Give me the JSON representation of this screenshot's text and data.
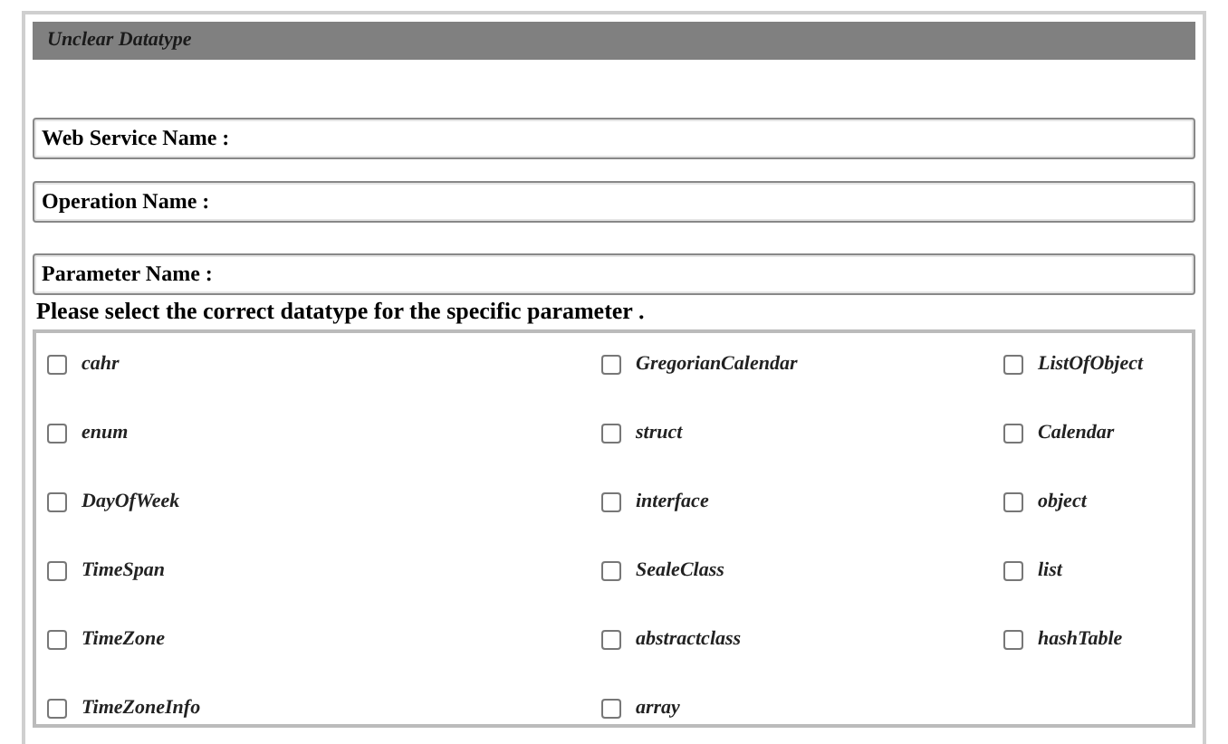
{
  "panel": {
    "title": "Unclear Datatype"
  },
  "fields": [
    {
      "label": "Web Service Name :"
    },
    {
      "label": "Operation Name :"
    },
    {
      "label": "Parameter Name :"
    }
  ],
  "instruction": "Please select the correct datatype for the specific parameter .",
  "options": [
    {
      "label": "cahr",
      "checked": false
    },
    {
      "label": "GregorianCalendar",
      "checked": false
    },
    {
      "label": "ListOfObject",
      "checked": false
    },
    {
      "label": "enum",
      "checked": false
    },
    {
      "label": "struct",
      "checked": false
    },
    {
      "label": "Calendar",
      "checked": false
    },
    {
      "label": "DayOfWeek",
      "checked": false
    },
    {
      "label": "interface",
      "checked": false
    },
    {
      "label": "object",
      "checked": false
    },
    {
      "label": "TimeSpan",
      "checked": false
    },
    {
      "label": "SealeClass",
      "checked": false
    },
    {
      "label": "list",
      "checked": false
    },
    {
      "label": "TimeZone",
      "checked": false
    },
    {
      "label": "abstractclass",
      "checked": false
    },
    {
      "label": "hashTable",
      "checked": false
    },
    {
      "label": "TimeZoneInfo",
      "checked": false
    },
    {
      "label": "array",
      "checked": false
    }
  ]
}
